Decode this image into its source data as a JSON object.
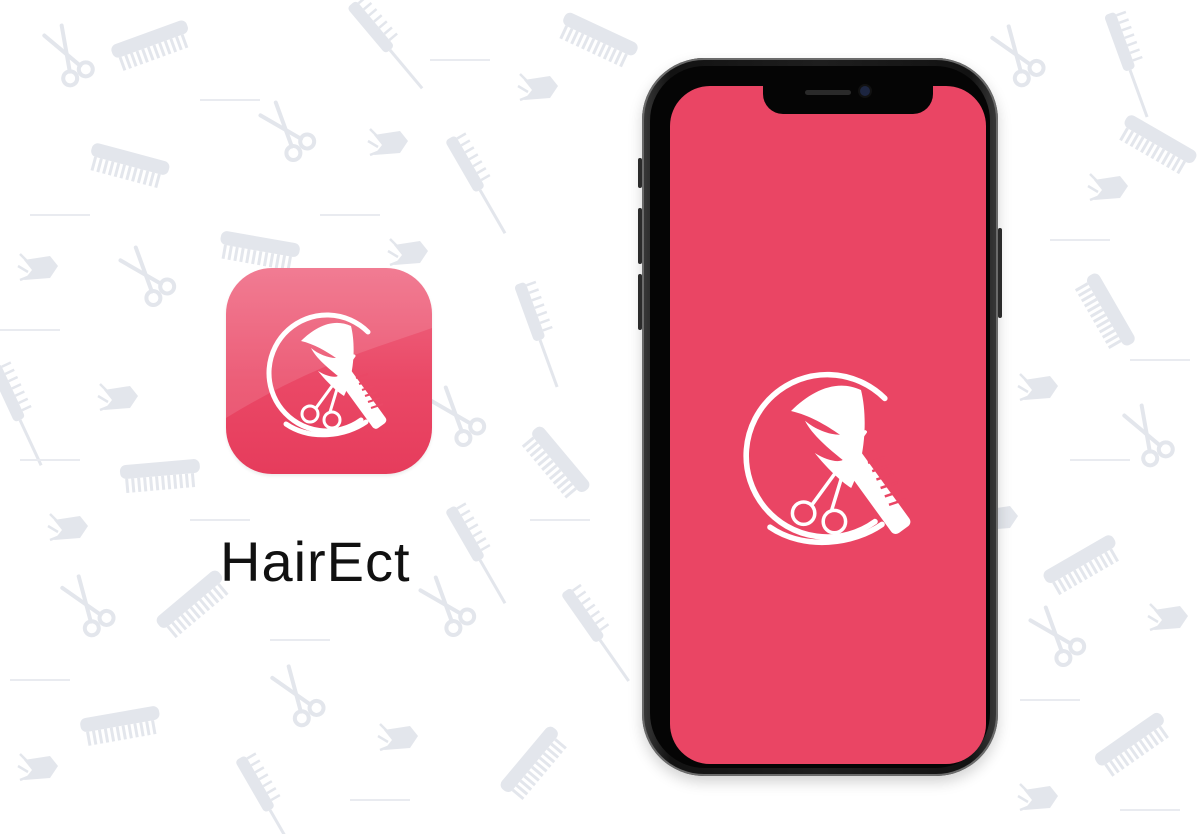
{
  "app": {
    "name": "HairEct"
  },
  "colors": {
    "brand": "#ea4564",
    "pattern": "#e3e6ec",
    "phone_frame": "#1a1a1a"
  },
  "icons": {
    "app_logo": "hair-scissors-comb-logo",
    "pattern": [
      "comb-icon",
      "scissors-icon",
      "fish-clip-icon",
      "tail-comb-icon"
    ]
  }
}
